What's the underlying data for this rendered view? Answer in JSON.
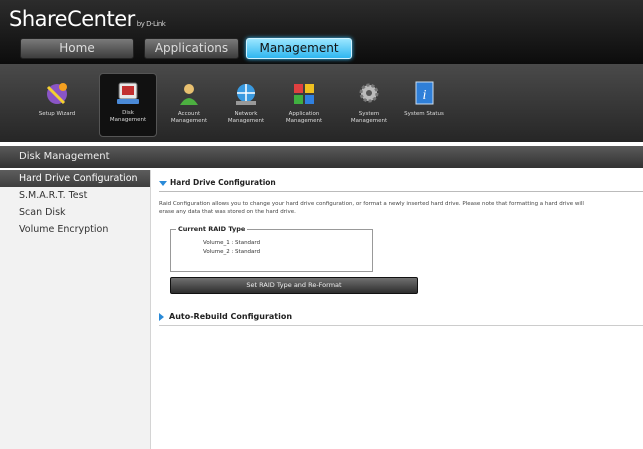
{
  "header": {
    "brand": "ShareCenter",
    "brand_suffix": "by D-Link",
    "tabs": [
      {
        "label": "Home"
      },
      {
        "label": "Applications"
      },
      {
        "label": "Management"
      }
    ],
    "active_tab": "Management"
  },
  "iconbar": {
    "items": [
      {
        "label": "Setup Wizard",
        "icon": "wizard-icon"
      },
      {
        "label": "Disk\nManagement",
        "icon": "disk-icon",
        "selected": true
      },
      {
        "label": "Account\nManagement",
        "icon": "account-icon"
      },
      {
        "label": "Network\nManagement",
        "icon": "network-icon"
      },
      {
        "label": "Application\nManagement",
        "icon": "application-icon"
      },
      {
        "label": "System\nManagement",
        "icon": "system-icon"
      },
      {
        "label": "System Status",
        "icon": "info-icon"
      }
    ]
  },
  "section": {
    "title": "Disk Management"
  },
  "sidebar": {
    "items": [
      {
        "label": "Hard Drive Configuration",
        "active": true
      },
      {
        "label": "S.M.A.R.T. Test"
      },
      {
        "label": "Scan Disk"
      },
      {
        "label": "Volume Encryption"
      }
    ]
  },
  "main": {
    "panel_title": "Hard Drive Configuration",
    "description_line1": "Raid Configuration allows you to change your hard drive configuration, or format a newly inserted hard drive. Please note that formatting a hard drive will",
    "description_line2": "erase any data that was stored on the hard drive.",
    "raid_legend": "Current RAID Type",
    "volumes": [
      "Volume_1 : Standard",
      "Volume_2 : Standard"
    ],
    "set_raid_button": "Set RAID Type and Re-Format",
    "auto_rebuild": "Auto-Rebuild Configuration"
  },
  "colors": {
    "accent": "#2fb6f0",
    "arrow": "#2a8ad8"
  }
}
